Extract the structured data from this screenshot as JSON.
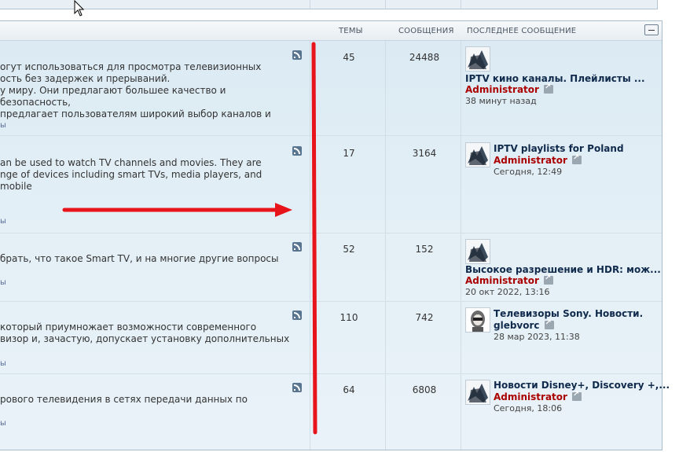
{
  "header": {
    "topics": "ТЕМЫ",
    "messages": "СООБЩЕНИЯ",
    "last_post": "ПОСЛЕДНЕЕ СООБЩЕНИЕ"
  },
  "forums": [
    {
      "desc_lines": [
        "огут использоваться для просмотра телевизионных",
        "ость без задержек и прерываний.",
        "у миру. Они предлагают большее качество и безопасность,",
        "предлагает пользователям широкий выбор каналов и"
      ],
      "subforums": "ы",
      "topics": "45",
      "messages": "24488",
      "last_title": "IPTV кино каналы. Плейлисты ...",
      "last_user": "Administrator",
      "last_time": "38 минут назад"
    },
    {
      "desc_lines": [
        "an be used to watch TV channels and movies. They are",
        "nge of devices including smart TVs, media players, and mobile"
      ],
      "subforums": "ы",
      "topics": "17",
      "messages": "3164",
      "last_title": "IPTV playlists for Poland",
      "last_user": "Administrator",
      "last_time": "Сегодня, 12:49"
    },
    {
      "desc_lines": [
        "брать, что такое Smart TV, и на многие другие вопросы"
      ],
      "subforums": "ы",
      "topics": "52",
      "messages": "152",
      "last_title": "Высокое разрешение и HDR: мож...",
      "last_user": "Administrator",
      "last_time": "20 окт 2022, 13:16"
    },
    {
      "desc_lines": [
        "который приумножает возможности современного",
        "визор и, зачастую, допускает установку дополнительных"
      ],
      "subforums": "ы",
      "topics": "110",
      "messages": "742",
      "last_title": "Телевизоры Sony. Новости.",
      "last_user": "glebvorc",
      "last_time": "28 мар 2023, 11:38"
    },
    {
      "desc_lines": [
        "рового телевидения в сетях передачи данных по"
      ],
      "subforums": "ы",
      "topics": "64",
      "messages": "6808",
      "last_title": "Новости Disney+, Discovery +,...",
      "last_user": "Administrator",
      "last_time": "Сегодня, 18:06"
    }
  ],
  "colors": {
    "annotation": "#e8141b",
    "username": "#aa0000",
    "title": "#102a4c"
  }
}
